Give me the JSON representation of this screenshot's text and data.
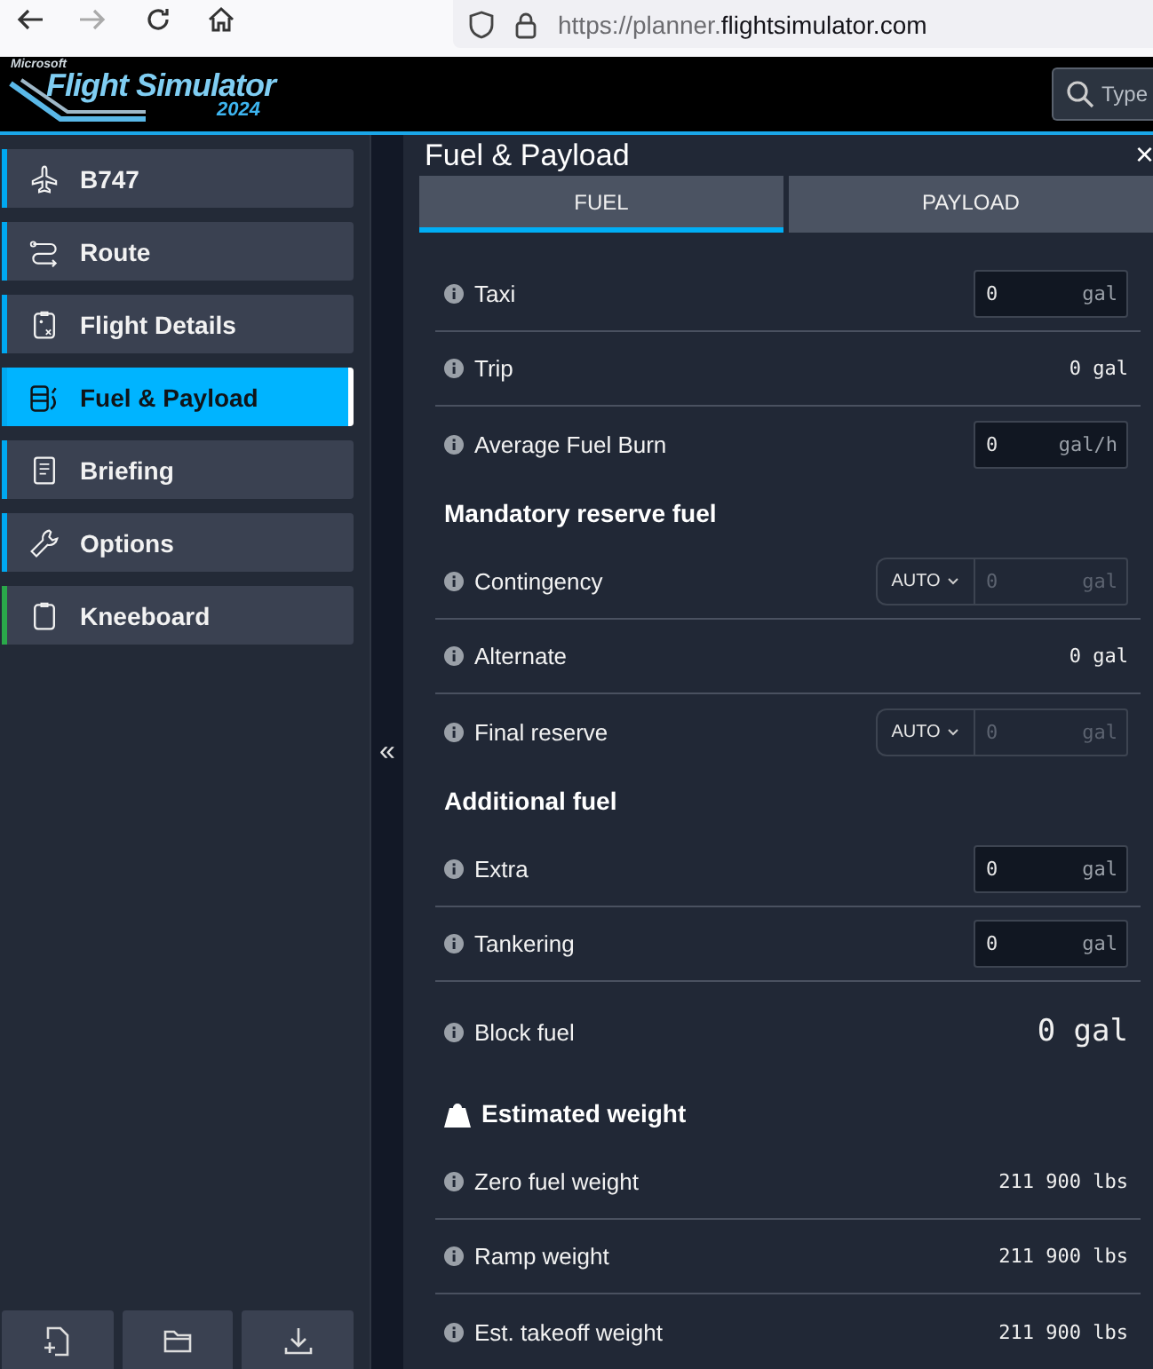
{
  "browser": {
    "url": {
      "scheme": "https://planner.",
      "host": "flightsimulator.com"
    }
  },
  "header": {
    "logo": {
      "maker": "Microsoft",
      "name": "Flight Simulator",
      "year": "2024"
    },
    "search": {
      "placeholder": "Type"
    }
  },
  "sidebar": {
    "items": [
      {
        "label": "B747",
        "selected": false,
        "color": "#00a8f0"
      },
      {
        "label": "Route",
        "selected": false,
        "color": "#00a8f0"
      },
      {
        "label": "Flight Details",
        "selected": false,
        "color": "#00a8f0"
      },
      {
        "label": "Fuel & Payload",
        "selected": true,
        "color": "#00a8f0"
      },
      {
        "label": "Briefing",
        "selected": false,
        "color": "#00a8f0"
      },
      {
        "label": "Options",
        "selected": false,
        "color": "#00a8f0"
      },
      {
        "label": "Kneeboard",
        "selected": false,
        "color": "#2aa84a"
      }
    ],
    "collapse": "«"
  },
  "panel": {
    "title": "Fuel & Payload",
    "close": "×",
    "tabs": [
      {
        "label": "FUEL",
        "selected": true
      },
      {
        "label": "PAYLOAD",
        "selected": false
      }
    ],
    "sections": [
      {
        "kind": "plain",
        "rows": [
          {
            "kind": "input",
            "label": "Taxi",
            "value": "0",
            "unit": "gal"
          },
          {
            "kind": "value",
            "label": "Trip",
            "value": "0 gal"
          },
          {
            "kind": "input",
            "label": "Average Fuel Burn",
            "value": "0",
            "unit": "gal/h"
          }
        ]
      },
      {
        "kind": "plain",
        "heading": "Mandatory reserve fuel",
        "rows": [
          {
            "kind": "auto",
            "label": "Contingency",
            "mode": "AUTO",
            "placeholder": "0",
            "unit": "gal"
          },
          {
            "kind": "value",
            "label": "Alternate",
            "value": "0 gal"
          },
          {
            "kind": "auto",
            "label": "Final reserve",
            "mode": "AUTO",
            "placeholder": "0",
            "unit": "gal"
          }
        ]
      },
      {
        "kind": "plain",
        "heading": "Additional fuel",
        "rows": [
          {
            "kind": "input",
            "label": "Extra",
            "value": "0",
            "unit": "gal"
          },
          {
            "kind": "input",
            "label": "Tankering",
            "value": "0",
            "unit": "gal"
          },
          {
            "kind": "total",
            "label": "Block fuel",
            "value": "0 gal"
          }
        ]
      },
      {
        "kind": "weight",
        "heading": "Estimated weight",
        "rows": [
          {
            "kind": "value",
            "label": "Zero fuel weight",
            "value": "211 900 lbs"
          },
          {
            "kind": "value",
            "label": "Ramp weight",
            "value": "211 900 lbs"
          },
          {
            "kind": "value",
            "label": "Est. takeoff weight",
            "value": "211 900 lbs"
          }
        ]
      }
    ]
  }
}
